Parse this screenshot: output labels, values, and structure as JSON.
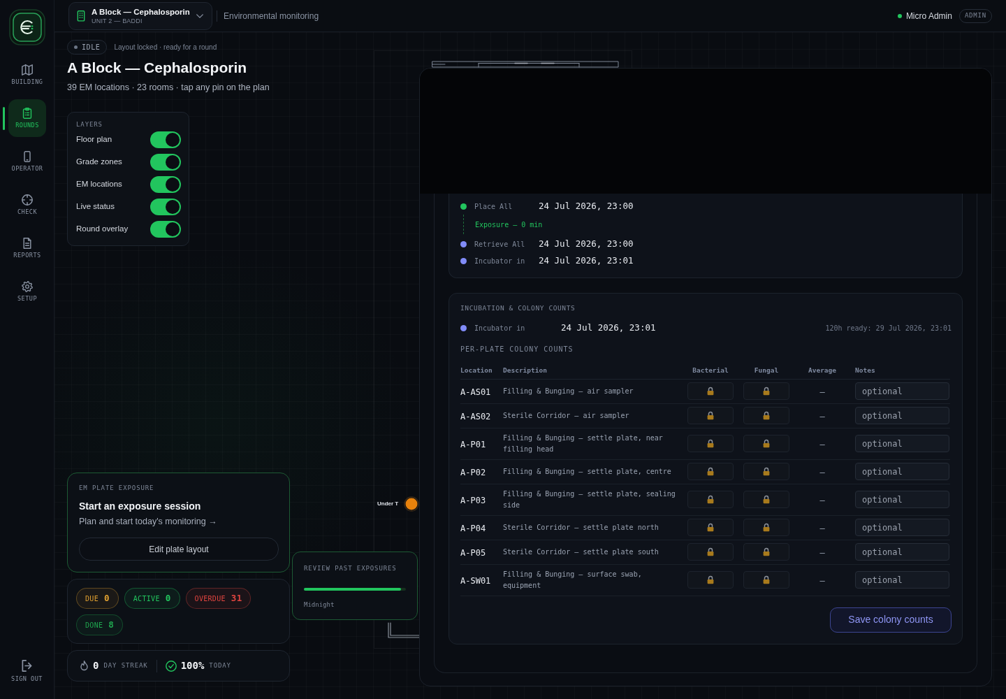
{
  "sidebar": {
    "items": [
      {
        "label": "BUILDING",
        "selected": false
      },
      {
        "label": "ROUNDS",
        "selected": true
      },
      {
        "label": "OPERATOR",
        "selected": false
      },
      {
        "label": "CHECK",
        "selected": false
      },
      {
        "label": "REPORTS",
        "selected": false
      },
      {
        "label": "SETUP",
        "selected": false
      }
    ],
    "sign_out": "SIGN OUT"
  },
  "header": {
    "project": {
      "title": "A Block — Cephalosporin",
      "subtitle": "UNIT 2 — BADDI"
    },
    "section": "Environmental monitoring",
    "user": {
      "name": "Micro Admin",
      "online": true,
      "role": "ADMIN"
    }
  },
  "status": {
    "state": "IDLE",
    "note": "Layout locked · ready for a round"
  },
  "page": {
    "title": "A Block — Cephalosporin",
    "subtitle": "39 EM locations · 23 rooms · tap any pin on the plan"
  },
  "layers": {
    "heading": "LAYERS",
    "items": [
      {
        "label": "Floor plan",
        "on": true
      },
      {
        "label": "Grade zones",
        "on": true
      },
      {
        "label": "EM locations",
        "on": true
      },
      {
        "label": "Live status",
        "on": true
      },
      {
        "label": "Round overlay",
        "on": true
      }
    ]
  },
  "plan": {
    "pins": [
      {
        "label": "Under T",
        "color": "#e8820c"
      }
    ]
  },
  "exposure": {
    "heading": "EM PLATE EXPOSURE",
    "title": "Start an exposure session",
    "link": "Plan and start today's monitoring →",
    "button": "Edit plate layout"
  },
  "counts": [
    {
      "label": "DUE",
      "value": "0",
      "color": "#e0a030"
    },
    {
      "label": "ACTIVE",
      "value": "0",
      "color": "#22c55e"
    },
    {
      "label": "OVERDUE",
      "value": "31",
      "color": "#e0443f"
    },
    {
      "label": "DONE",
      "value": "8",
      "color": "#1fa54e"
    }
  ],
  "streak": {
    "value": "0",
    "label": "DAY STREAK",
    "rate": "100%",
    "rate_label": "TODAY"
  },
  "review": {
    "heading": "REVIEW PAST EXPOSURES",
    "level": 0.95,
    "caption": "Midnight"
  },
  "modal": {
    "timeline": [
      {
        "kind": "event",
        "label": "Place All",
        "time": "24 Jul 2026, 23:00",
        "color": "#22c55e"
      },
      {
        "kind": "interval",
        "label": "Exposure — 0 min"
      },
      {
        "kind": "event",
        "label": "Retrieve All",
        "time": "24 Jul 2026, 23:00",
        "color": "#818cf8"
      },
      {
        "kind": "event",
        "label": "Incubator in",
        "time": "24 Jul 2026, 23:01",
        "color": "#818cf8"
      }
    ],
    "incubation": {
      "heading": "INCUBATION & COLONY COUNTS",
      "event": {
        "label": "Incubator in",
        "time": "24 Jul 2026, 23:01",
        "color": "#818cf8"
      },
      "ready": "120h ready: 29 Jul 2026, 23:01",
      "table_heading": "PER-PLATE COLONY COUNTS",
      "columns": [
        "Location",
        "Description",
        "Bacterial",
        "Fungal",
        "Average",
        "Notes"
      ],
      "rows": [
        {
          "location": "A-AS01",
          "description": "Filling & Bunging — air sampler",
          "bacterial": {
            "locked": true
          },
          "fungal": {
            "locked": true
          },
          "average": "—",
          "notes": {
            "placeholder": "optional"
          }
        },
        {
          "location": "A-AS02",
          "description": "Sterile Corridor — air sampler",
          "bacterial": {
            "locked": true
          },
          "fungal": {
            "locked": true
          },
          "average": "—",
          "notes": {
            "placeholder": "optional"
          }
        },
        {
          "location": "A-P01",
          "description": "Filling & Bunging — settle plate, near filling head",
          "bacterial": {
            "locked": true
          },
          "fungal": {
            "locked": true
          },
          "average": "—",
          "notes": {
            "placeholder": "optional"
          }
        },
        {
          "location": "A-P02",
          "description": "Filling & Bunging — settle plate, centre",
          "bacterial": {
            "locked": true
          },
          "fungal": {
            "locked": true
          },
          "average": "—",
          "notes": {
            "placeholder": "optional"
          }
        },
        {
          "location": "A-P03",
          "description": "Filling & Bunging — settle plate, sealing side",
          "bacterial": {
            "locked": true
          },
          "fungal": {
            "locked": true
          },
          "average": "—",
          "notes": {
            "placeholder": "optional"
          }
        },
        {
          "location": "A-P04",
          "description": "Sterile Corridor — settle plate north",
          "bacterial": {
            "locked": true
          },
          "fungal": {
            "locked": true
          },
          "average": "—",
          "notes": {
            "placeholder": "optional"
          }
        },
        {
          "location": "A-P05",
          "description": "Sterile Corridor — settle plate south",
          "bacterial": {
            "locked": true
          },
          "fungal": {
            "locked": true
          },
          "average": "—",
          "notes": {
            "placeholder": "optional"
          }
        },
        {
          "location": "A-SW01",
          "description": "Filling & Bunging — surface swab, equipment",
          "bacterial": {
            "locked": true
          },
          "fungal": {
            "locked": true
          },
          "average": "—",
          "notes": {
            "placeholder": "optional"
          }
        }
      ],
      "save_button": "Save colony counts"
    }
  }
}
